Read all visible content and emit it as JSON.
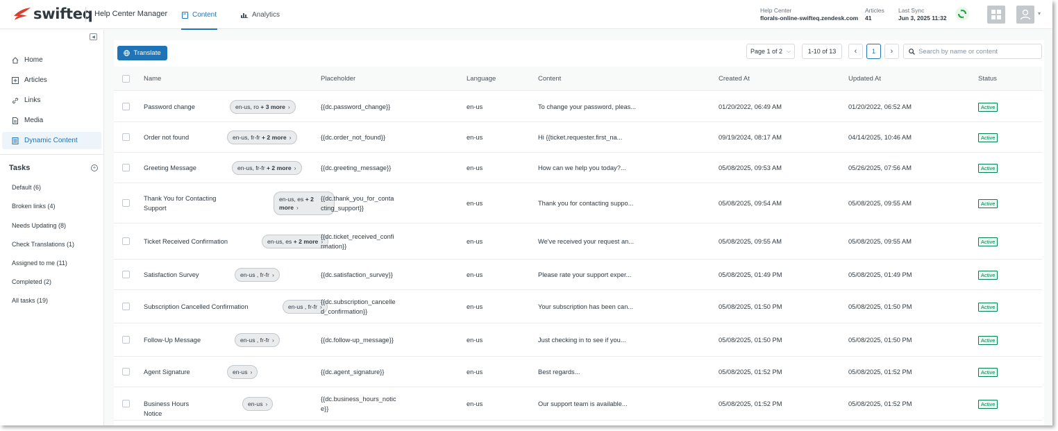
{
  "header": {
    "logo_text": "swifteq",
    "app_title": "Help Center Manager",
    "tabs": [
      {
        "label": "Content",
        "active": true
      },
      {
        "label": "Analytics",
        "active": false
      }
    ],
    "help_center_label": "Help Center",
    "help_center_value": "florals-online-swifteq.zendesk.com",
    "articles_label": "Articles",
    "articles_value": "41",
    "last_sync_label": "Last Sync",
    "last_sync_value": "Jun 3, 2025 11:32"
  },
  "sidebar": {
    "items": [
      {
        "label": "Home",
        "icon": "home-icon",
        "active": false
      },
      {
        "label": "Articles",
        "icon": "articles-icon",
        "active": false
      },
      {
        "label": "Links",
        "icon": "link-icon",
        "active": false
      },
      {
        "label": "Media",
        "icon": "media-icon",
        "active": false
      },
      {
        "label": "Dynamic Content",
        "icon": "dynamic-content-icon",
        "active": true
      }
    ],
    "tasks_title": "Tasks",
    "tasks": [
      "Default (6)",
      "Broken links (4)",
      "Needs Updating (8)",
      "Check Translations (1)",
      "Assigned to me (11)",
      "Completed (2)",
      "All tasks (19)"
    ]
  },
  "toolbar": {
    "translate_label": "Translate",
    "page_select": "Page 1 of 2",
    "range": "1-10 of 13",
    "current_page": "1",
    "search_placeholder": "Search by name or content"
  },
  "table": {
    "columns": [
      "Name",
      "Placeholder",
      "Language",
      "Content",
      "Created At",
      "Updated At",
      "Status"
    ],
    "rows": [
      {
        "name": [
          "Password change"
        ],
        "pill_langs": "en-us, ro",
        "pill_more": "+ 3 more",
        "placeholder": [
          "{{dc.password_change}}"
        ],
        "language": "en-us",
        "content": "To change your password, pleas...",
        "created": "01/20/2022, 06:49 AM",
        "updated": "01/20/2022, 06:52 AM",
        "status": "Active"
      },
      {
        "name": [
          "Order not found"
        ],
        "pill_langs": "en-us, fr-fr",
        "pill_more": "+ 2 more",
        "placeholder": [
          "{{dc.order_not_found}}"
        ],
        "language": "en-us",
        "content": "Hi {{ticket.requester.first_na...",
        "created": "09/19/2024, 08:17 AM",
        "updated": "04/14/2025, 10:46 AM",
        "status": "Active"
      },
      {
        "name": [
          "Greeting Message"
        ],
        "pill_langs": "en-us, fr-fr",
        "pill_more": "+ 2 more",
        "placeholder": [
          "{{dc.greeting_message}}"
        ],
        "language": "en-us",
        "content": "How can we help you today?...",
        "created": "05/08/2025, 09:53 AM",
        "updated": "05/26/2025, 07:56 AM",
        "status": "Active"
      },
      {
        "name": [
          "Thank You for Contacting",
          "Support"
        ],
        "pill_langs": "en-us, es",
        "pill_more": "+ 2 more",
        "placeholder": [
          "{{dc.thank_you_for_conta",
          "cting_support}}"
        ],
        "language": "en-us",
        "content": "Thank you for contacting suppo...",
        "created": "05/08/2025, 09:54 AM",
        "updated": "05/08/2025, 09:55 AM",
        "status": "Active"
      },
      {
        "name": [
          "Ticket Received Confirmation"
        ],
        "pill_langs": "en-us, es",
        "pill_more": "+ 2 more",
        "placeholder": [
          "{{dc.ticket_received_confi",
          "rmation}}"
        ],
        "language": "en-us",
        "content": "We've received your request an...",
        "created": "05/08/2025, 09:55 AM",
        "updated": "05/08/2025, 09:55 AM",
        "status": "Active"
      },
      {
        "name": [
          "Satisfaction Survey"
        ],
        "pill_langs": "en-us , fr-fr",
        "pill_more": "",
        "placeholder": [
          "{{dc.satisfaction_survey}}"
        ],
        "language": "en-us",
        "content": "Please rate your support exper...",
        "created": "05/08/2025, 01:49 PM",
        "updated": "05/08/2025, 01:49 PM",
        "status": "Active"
      },
      {
        "name": [
          "Subscription Cancelled Confirmation"
        ],
        "pill_langs": "en-us , fr-fr",
        "pill_more": "",
        "placeholder": [
          "{{dc.subscription_cancelle",
          "d_confirmation}}"
        ],
        "language": "en-us",
        "content": "Your subscription has been can...",
        "created": "05/08/2025, 01:50 PM",
        "updated": "05/08/2025, 01:50 PM",
        "status": "Active"
      },
      {
        "name": [
          "Follow-Up Message"
        ],
        "pill_langs": "en-us , fr-fr",
        "pill_more": "",
        "placeholder": [
          "{{dc.follow-up_message}}"
        ],
        "language": "en-us",
        "content": "Just checking in to see if you...",
        "created": "05/08/2025, 01:50 PM",
        "updated": "05/08/2025, 01:50 PM",
        "status": "Active"
      },
      {
        "name": [
          "Agent Signature"
        ],
        "pill_langs": "en-us",
        "pill_more": "",
        "placeholder": [
          "{{dc.agent_signature}}"
        ],
        "language": "en-us",
        "content": "Best regards...",
        "created": "05/08/2025, 01:52 PM",
        "updated": "05/08/2025, 01:52 PM",
        "status": "Active"
      },
      {
        "name": [
          "Business Hours Notice"
        ],
        "pill_langs": "en-us",
        "pill_more": "",
        "placeholder": [
          "{{dc.business_hours_notic",
          "e}}"
        ],
        "language": "en-us",
        "content": "Our support team is available...",
        "created": "05/08/2025, 01:52 PM",
        "updated": "05/08/2025, 01:52 PM",
        "status": "Active"
      }
    ]
  },
  "colors": {
    "accent": "#1f73b7",
    "logo_red": "#d93f2e",
    "status_green": "#038153",
    "sync_green": "#2e9e47"
  }
}
